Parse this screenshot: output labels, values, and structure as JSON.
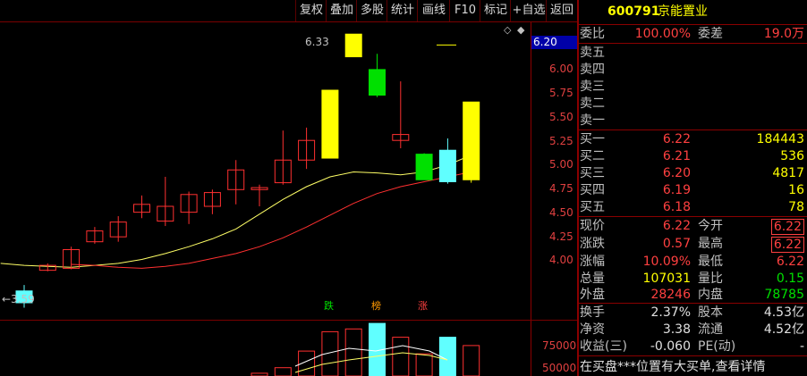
{
  "toolbar": {
    "buttons": [
      "复权",
      "叠加",
      "多股",
      "统计",
      "画线",
      "F10",
      "标记",
      "+自选",
      "返回"
    ]
  },
  "chart": {
    "current_price_badge": "6.20",
    "y_ticks": [
      "6.00",
      "5.75",
      "5.50",
      "5.25",
      "5.00",
      "4.75",
      "4.50",
      "4.25",
      "4.00"
    ],
    "high_label": "6.33",
    "low_label": "←3.59",
    "markers": [
      {
        "text": "跌",
        "color": "#00e000"
      },
      {
        "text": "榜",
        "color": "#ff9900"
      },
      {
        "text": "涨",
        "color": "#ff4040"
      }
    ],
    "volume_ticks": [
      "75000",
      "50000"
    ],
    "controls": [
      "◇",
      "◆"
    ]
  },
  "chart_data": {
    "type": "candlestick",
    "ylim": [
      3.5,
      6.45
    ],
    "candles": [
      {
        "o": 3.6,
        "c": 3.72,
        "h": 3.78,
        "l": 3.55,
        "up": true
      },
      {
        "o": 3.98,
        "c": 3.93,
        "h": 4.0,
        "l": 3.92,
        "up": false
      },
      {
        "o": 3.95,
        "c": 4.14,
        "h": 4.17,
        "l": 3.94,
        "up": true
      },
      {
        "o": 4.22,
        "c": 4.33,
        "h": 4.37,
        "l": 4.2,
        "up": true
      },
      {
        "o": 4.27,
        "c": 4.42,
        "h": 4.48,
        "l": 4.22,
        "up": true
      },
      {
        "o": 4.52,
        "c": 4.6,
        "h": 4.69,
        "l": 4.46,
        "up": true
      },
      {
        "o": 4.58,
        "c": 4.43,
        "h": 4.88,
        "l": 4.38,
        "up": true
      },
      {
        "o": 4.52,
        "c": 4.7,
        "h": 4.73,
        "l": 4.4,
        "up": true
      },
      {
        "o": 4.58,
        "c": 4.72,
        "h": 4.75,
        "l": 4.5,
        "up": true
      },
      {
        "o": 4.75,
        "c": 4.95,
        "h": 5.05,
        "l": 4.6,
        "up": true
      },
      {
        "o": 4.77,
        "c": 4.75,
        "h": 4.8,
        "l": 4.58,
        "up": true
      },
      {
        "o": 4.82,
        "c": 5.05,
        "h": 5.35,
        "l": 4.8,
        "up": true
      },
      {
        "o": 5.05,
        "c": 5.25,
        "h": 5.38,
        "l": 4.96,
        "up": true
      },
      {
        "o": 5.07,
        "c": 5.76,
        "h": 5.76,
        "l": 5.07,
        "up": true,
        "limit": true
      },
      {
        "o": 6.1,
        "c": 6.33,
        "h": 6.33,
        "l": 6.1,
        "up": true,
        "limit": true
      },
      {
        "o": 5.97,
        "c": 5.71,
        "h": 6.13,
        "l": 5.69,
        "down": true
      },
      {
        "o": 5.25,
        "c": 5.31,
        "h": 5.85,
        "l": 5.17,
        "up": true
      },
      {
        "o": 5.11,
        "c": 4.85,
        "h": 5.12,
        "l": 4.85,
        "down": true
      },
      {
        "o": 4.83,
        "c": 5.15,
        "h": 5.27,
        "l": 4.81,
        "up": true
      },
      {
        "o": 4.85,
        "c": 5.64,
        "h": 5.64,
        "l": 4.82,
        "up": true,
        "limit": true
      }
    ],
    "ma_yellow": [
      4.0,
      3.98,
      3.97,
      3.96,
      3.98,
      4.0,
      4.04,
      4.1,
      4.17,
      4.25,
      4.35,
      4.5,
      4.65,
      4.78,
      4.88,
      4.93,
      4.92,
      4.9,
      4.93,
      5.0,
      5.1
    ],
    "ma_red": [
      3.99,
      3.98,
      3.96,
      3.95,
      3.97,
      4.0,
      4.05,
      4.1,
      4.17,
      4.26,
      4.37,
      4.49,
      4.61,
      4.71,
      4.78,
      4.83,
      4.88,
      4.93
    ]
  },
  "quote": {
    "code": "600791",
    "name": "京能置业",
    "weibi_label": "委比",
    "weibi_value": "100.00%",
    "weicha_label": "委差",
    "weicha_value": "19.0万",
    "sells": [
      {
        "label": "卖五",
        "price": "",
        "vol": ""
      },
      {
        "label": "卖四",
        "price": "",
        "vol": ""
      },
      {
        "label": "卖三",
        "price": "",
        "vol": ""
      },
      {
        "label": "卖二",
        "price": "",
        "vol": ""
      },
      {
        "label": "卖一",
        "price": "",
        "vol": ""
      }
    ],
    "buys": [
      {
        "label": "买一",
        "price": "6.22",
        "vol": "184443"
      },
      {
        "label": "买二",
        "price": "6.21",
        "vol": "536"
      },
      {
        "label": "买三",
        "price": "6.20",
        "vol": "4817"
      },
      {
        "label": "买四",
        "price": "6.19",
        "vol": "16"
      },
      {
        "label": "买五",
        "price": "6.18",
        "vol": "78"
      }
    ],
    "stats": [
      {
        "l1": "现价",
        "v1": "6.22",
        "l2": "今开",
        "v2": "6.22"
      },
      {
        "l1": "涨跌",
        "v1": "0.57",
        "l2": "最高",
        "v2": "6.22"
      },
      {
        "l1": "涨幅",
        "v1": "10.09%",
        "l2": "最低",
        "v2": "6.22"
      },
      {
        "l1": "总量",
        "v1": "107031",
        "l2": "量比",
        "v2": "0.15"
      },
      {
        "l1": "外盘",
        "v1": "28246",
        "l2": "内盘",
        "v2": "78785"
      }
    ],
    "stats2": [
      {
        "l1": "换手",
        "v1": "2.37%",
        "l2": "股本",
        "v2": "4.53亿"
      },
      {
        "l1": "净资",
        "v1": "3.38",
        "l2": "流通",
        "v2": "4.52亿"
      },
      {
        "l1": "收益(三)",
        "v1": "-0.060",
        "l2": "PE(动)",
        "v2": "-"
      }
    ],
    "bottom_text": "在买盘***位置有大买单,查看详情"
  }
}
